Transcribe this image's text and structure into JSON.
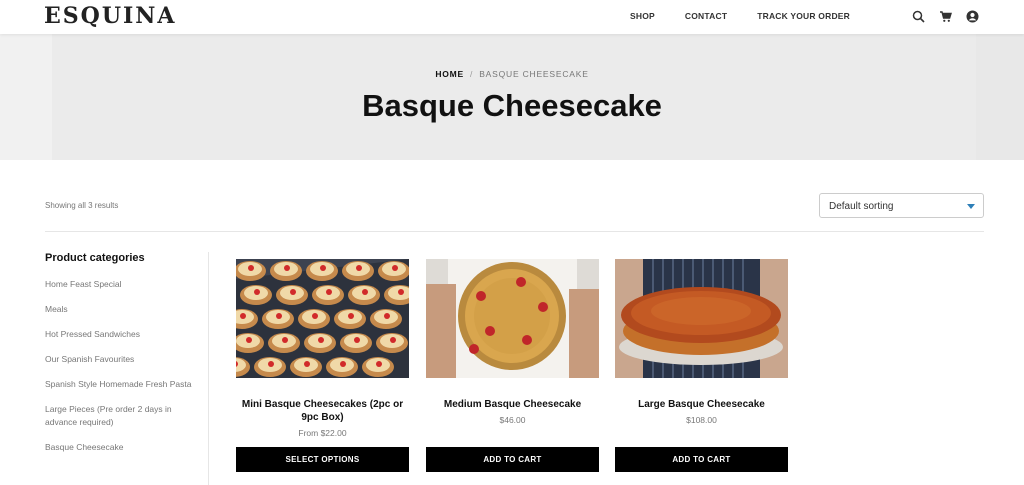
{
  "header": {
    "logo": "ESQUINA",
    "nav": [
      "SHOP",
      "CONTACT",
      "TRACK YOUR ORDER"
    ],
    "icons": [
      "search-icon",
      "cart-icon",
      "account-icon"
    ]
  },
  "hero": {
    "breadcrumb": {
      "home": "HOME",
      "separator": "/",
      "current": "BASQUE CHEESECAKE"
    },
    "title": "Basque Cheesecake"
  },
  "toolbar": {
    "result_count": "Showing all 3 results",
    "sort_selected": "Default sorting"
  },
  "sidebar": {
    "title": "Product categories",
    "categories": [
      "Home Feast Special",
      "Meals",
      "Hot Pressed Sandwiches",
      "Our Spanish Favourites",
      "Spanish Style Homemade Fresh Pasta",
      "Large Pieces (Pre order 2 days in advance required)",
      "Basque Cheesecake"
    ]
  },
  "products": [
    {
      "name": "Mini Basque Cheesecakes (2pc or 9pc Box)",
      "price": "From $22.00",
      "button": "SELECT OPTIONS"
    },
    {
      "name": "Medium Basque Cheesecake",
      "price": "$46.00",
      "button": "ADD TO CART"
    },
    {
      "name": "Large Basque Cheesecake",
      "price": "$108.00",
      "button": "ADD TO CART"
    }
  ],
  "colors": {
    "accent": "#2e7fb8",
    "button_bg": "#000000",
    "hero_bg": "#ebebeb"
  }
}
